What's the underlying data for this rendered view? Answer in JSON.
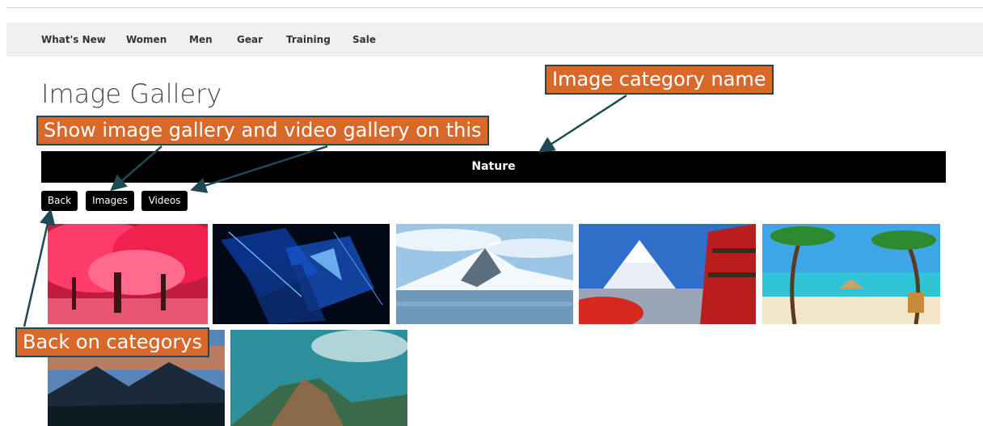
{
  "nav": {
    "items": [
      "What's New",
      "Women",
      "Men",
      "Gear",
      "Training",
      "Sale"
    ]
  },
  "page": {
    "title": "Image Gallery"
  },
  "category": {
    "name": "Nature"
  },
  "buttons": {
    "back": "Back",
    "images": "Images",
    "videos": "Videos"
  },
  "gallery": {
    "images": [
      {
        "subject": "pink-blossom-trees"
      },
      {
        "subject": "blue-abstract-glass"
      },
      {
        "subject": "snowy-mountain-lake"
      },
      {
        "subject": "mount-fuji-pagoda"
      },
      {
        "subject": "tropical-beach-palms"
      },
      {
        "subject": "volcano-sunset"
      },
      {
        "subject": "mountain-ridge-sky"
      }
    ]
  },
  "annotations": {
    "category_callout": "Image category name",
    "gallery_callout": "Show image gallery and video gallery on this",
    "back_callout": "Back on categorys",
    "callout_color": "#d9692a",
    "arrow_color": "#1f4a55"
  }
}
